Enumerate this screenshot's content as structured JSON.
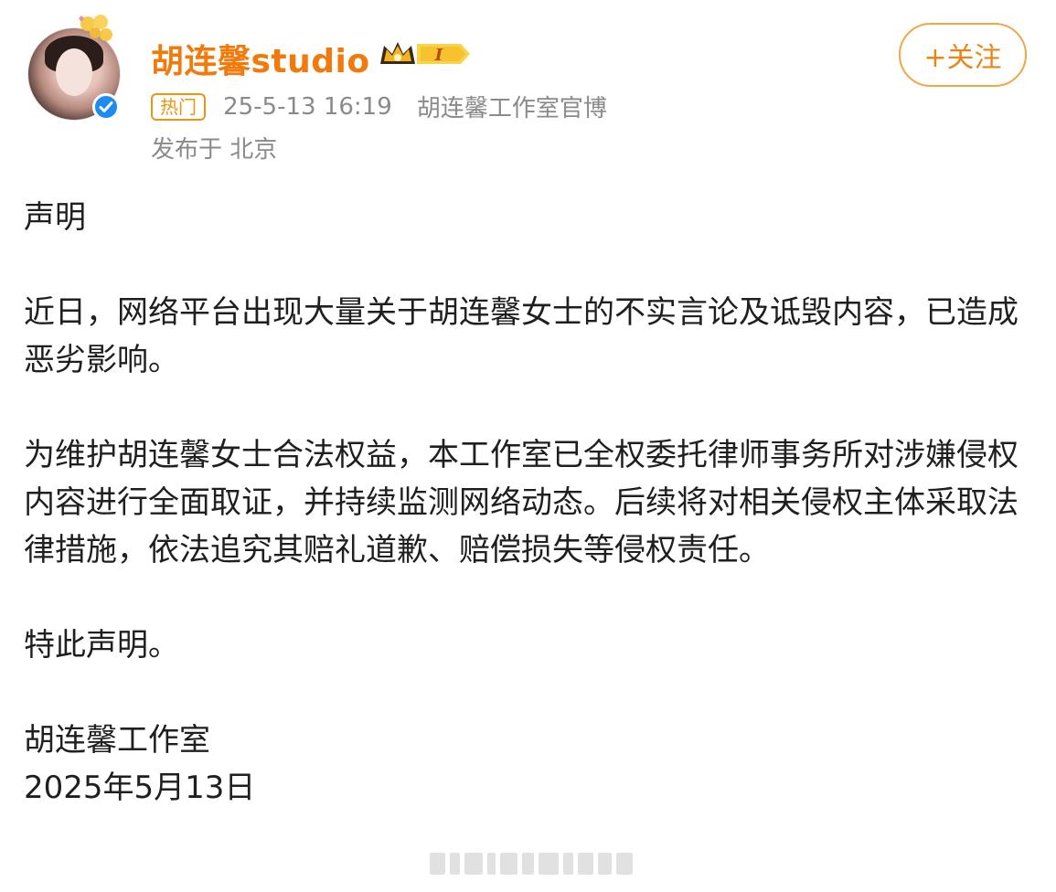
{
  "header": {
    "avatar_icon": "user-avatar",
    "username": "胡连馨studio",
    "member_badge_label": "I",
    "hot_badge": "热门",
    "timestamp": "25-5-13 16:19",
    "source": "胡连馨工作室官博",
    "location": "发布于 北京",
    "follow_button": "+关注",
    "accent_color": "#f27a0a",
    "verified_color": "#1d8bf1"
  },
  "post": {
    "title": "声明",
    "paragraphs": [
      "近日，网络平台出现大量关于胡连馨女士的不实言论及诋毁内容，已造成恶劣影响。",
      "为维护胡连馨女士合法权益，本工作室已全权委托律师事务所对涉嫌侵权内容进行全面取证，并持续监测网络动态。后续将对相关侵权主体采取法律措施，依法追究其赔礼道歉、赔偿损失等侵权责任。",
      "特此声明。"
    ],
    "signature": "胡连馨工作室",
    "date": "2025年5月13日"
  }
}
